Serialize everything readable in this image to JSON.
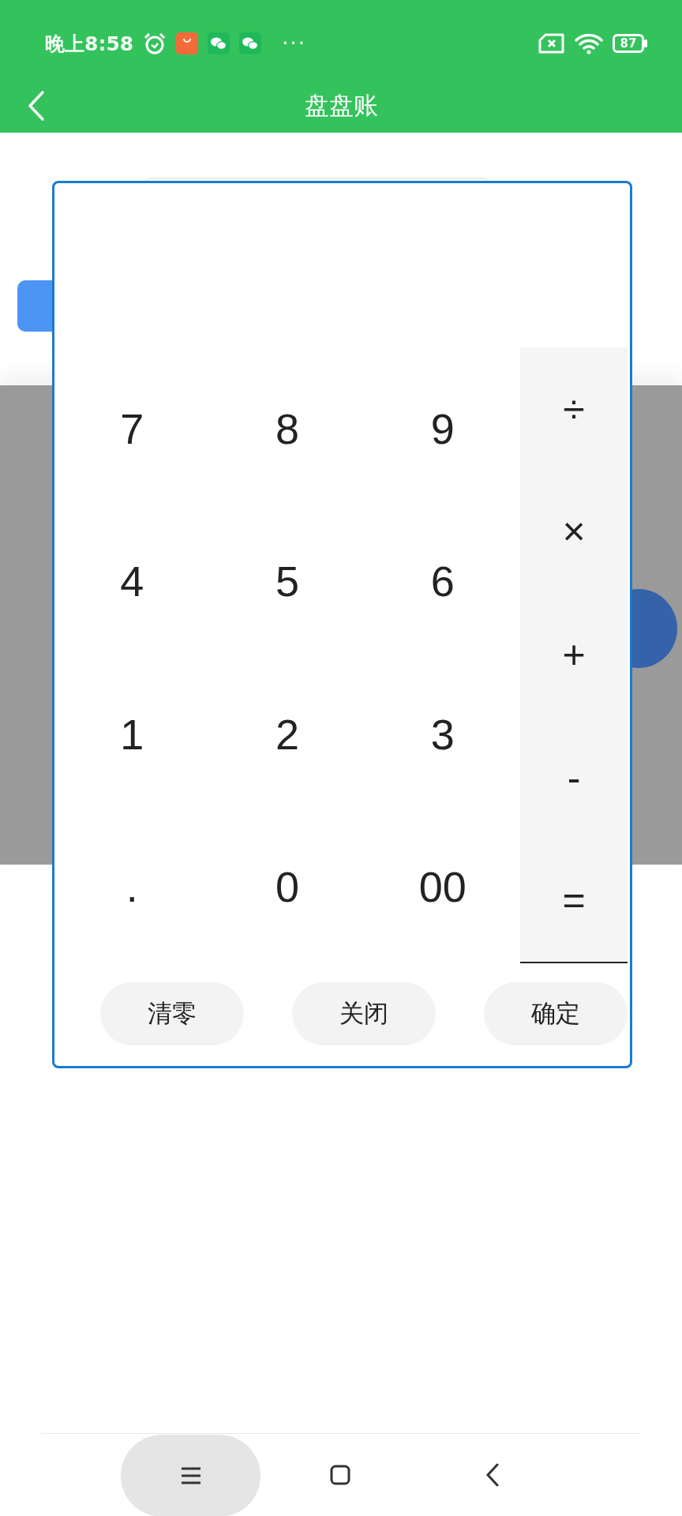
{
  "status_bar": {
    "time": "晚上8:58",
    "more": "···",
    "battery": "87"
  },
  "header": {
    "title": "盘盘账"
  },
  "keypad": {
    "digits": [
      {
        "label": "7"
      },
      {
        "label": "8"
      },
      {
        "label": "9"
      },
      {
        "label": "4"
      },
      {
        "label": "5"
      },
      {
        "label": "6"
      },
      {
        "label": "1"
      },
      {
        "label": "2"
      },
      {
        "label": "3"
      },
      {
        "label": "."
      },
      {
        "label": "0"
      },
      {
        "label": "00"
      }
    ],
    "operators": [
      {
        "label": "÷"
      },
      {
        "label": "×"
      },
      {
        "label": "+"
      },
      {
        "label": "-"
      },
      {
        "label": "="
      }
    ],
    "actions": [
      {
        "label": "清零"
      },
      {
        "label": "关闭"
      },
      {
        "label": "确定"
      }
    ]
  }
}
